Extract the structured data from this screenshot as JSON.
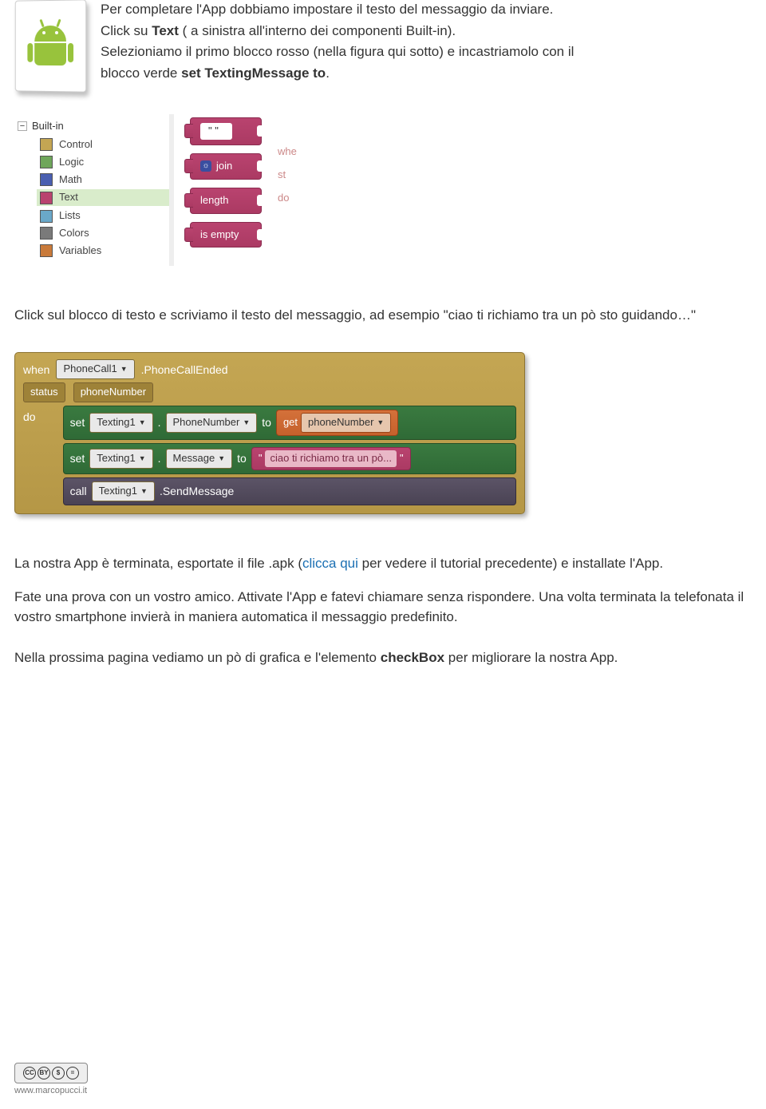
{
  "intro": {
    "l1a": "Per completare l'App dobbiamo impostare il testo del messaggio da inviare.",
    "l2a": "Click su ",
    "l2b": "Text",
    "l2c": " ( a sinistra all'interno dei componenti Built-in).",
    "l3a": "Selezioniamo il primo blocco rosso (nella figura qui sotto) e incastriamolo con il",
    "l4a": "blocco verde ",
    "l4b": "set TextingMessage to",
    "l4c": "."
  },
  "builtins": {
    "header": "Built-in",
    "items": [
      {
        "label": "Control",
        "color": "#c4a653"
      },
      {
        "label": "Logic",
        "color": "#6fa65b"
      },
      {
        "label": "Math",
        "color": "#4a5fb0"
      },
      {
        "label": "Text",
        "color": "#b9436f",
        "selected": true
      },
      {
        "label": "Lists",
        "color": "#6aa8c9"
      },
      {
        "label": "Colors",
        "color": "#7a7a7a"
      },
      {
        "label": "Variables",
        "color": "#c97a3a"
      }
    ],
    "blocks": {
      "text_literal": "\" \"",
      "join": "join",
      "length": "length",
      "is_empty": "is empty"
    },
    "faint": {
      "when": "whe",
      "st": "st",
      "do": "do"
    }
  },
  "para2": "Click sul blocco di testo e scriviamo il testo del messaggio, ad esempio \"ciao ti richiamo tra un pò sto guidando…\"",
  "eventBlock": {
    "when": "when",
    "phoneCall": "PhoneCall1",
    "eventName": ".PhoneCallEnded",
    "status": "status",
    "phoneNumber": "phoneNumber",
    "do": "do",
    "set": "set",
    "texting": "Texting1",
    "dot": ".",
    "propPhone": "PhoneNumber",
    "to": "to",
    "get": "get",
    "getVar": "phoneNumber",
    "propMsg": "Message",
    "msgText": "ciao ti richiamo tra un pò...",
    "call": "call",
    "send": ".SendMessage"
  },
  "para3": {
    "a": "La nostra App è terminata, esportate il file .apk (",
    "link": "clicca qui",
    "b": " per vedere il tutorial precedente) e installate l'App."
  },
  "para4": "Fate una prova con un vostro amico. Attivate l'App e fatevi chiamare senza rispondere. Una volta terminata la telefonata il vostro smartphone invierà in maniera automatica il messaggio predefinito.",
  "para5a": "Nella prossima pagina vediamo un pò di grafica e l'elemento ",
  "para5b": "checkBox",
  "para5c": " per migliorare la nostra App.",
  "footer": {
    "cc": "CC",
    "by": "BY",
    "nc": "$",
    "nd": "=",
    "site": "www.marcopucci.it"
  }
}
